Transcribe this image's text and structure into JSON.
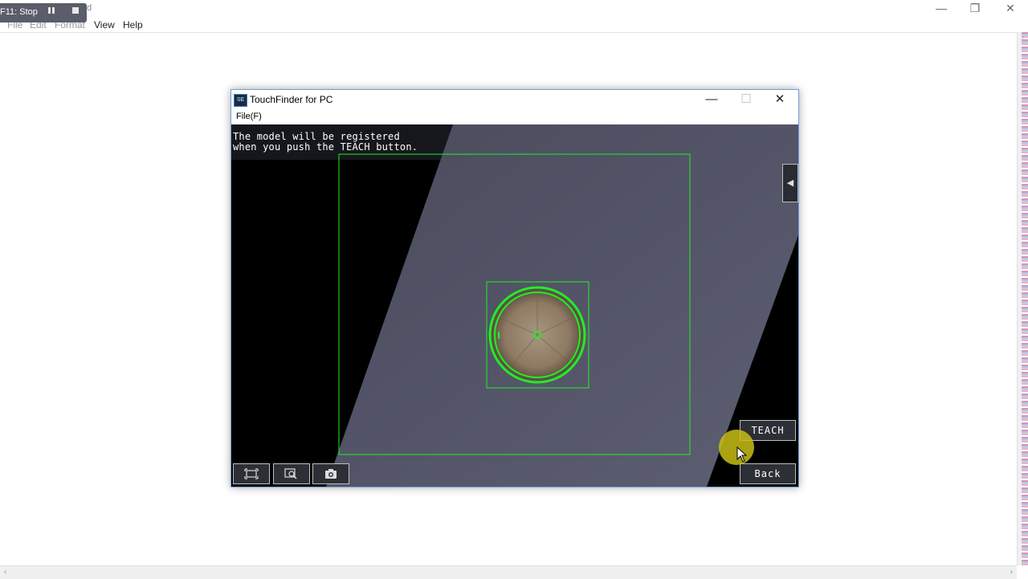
{
  "notepad": {
    "title_fragment": "d",
    "menu": [
      "File",
      "Edit",
      "Format",
      "View",
      "Help"
    ],
    "window_controls": [
      "—",
      "❐",
      "✕"
    ]
  },
  "recorder": {
    "label": "F11: Stop",
    "pause_icon": "pause-icon",
    "stop_icon": "stop-icon"
  },
  "touchfinder": {
    "title": "TouchFinder for PC",
    "icon_text": "SE",
    "menu": [
      "File(F)"
    ],
    "window_controls": [
      "—",
      "☐",
      "✕"
    ],
    "message_line1": "The model will be registered",
    "message_line2": "when you push the TEACH button.",
    "side_tab_glyph": "◀",
    "teach_label": "TEACH",
    "back_label": "Back",
    "tools": [
      "fit-screen-icon",
      "zoom-icon",
      "camera-icon"
    ]
  },
  "colors": {
    "overlay_green": "#22ee22",
    "panel_bg": "#2d2f36",
    "view_bg": "#000000",
    "cursor_halo": "#c8be14"
  }
}
